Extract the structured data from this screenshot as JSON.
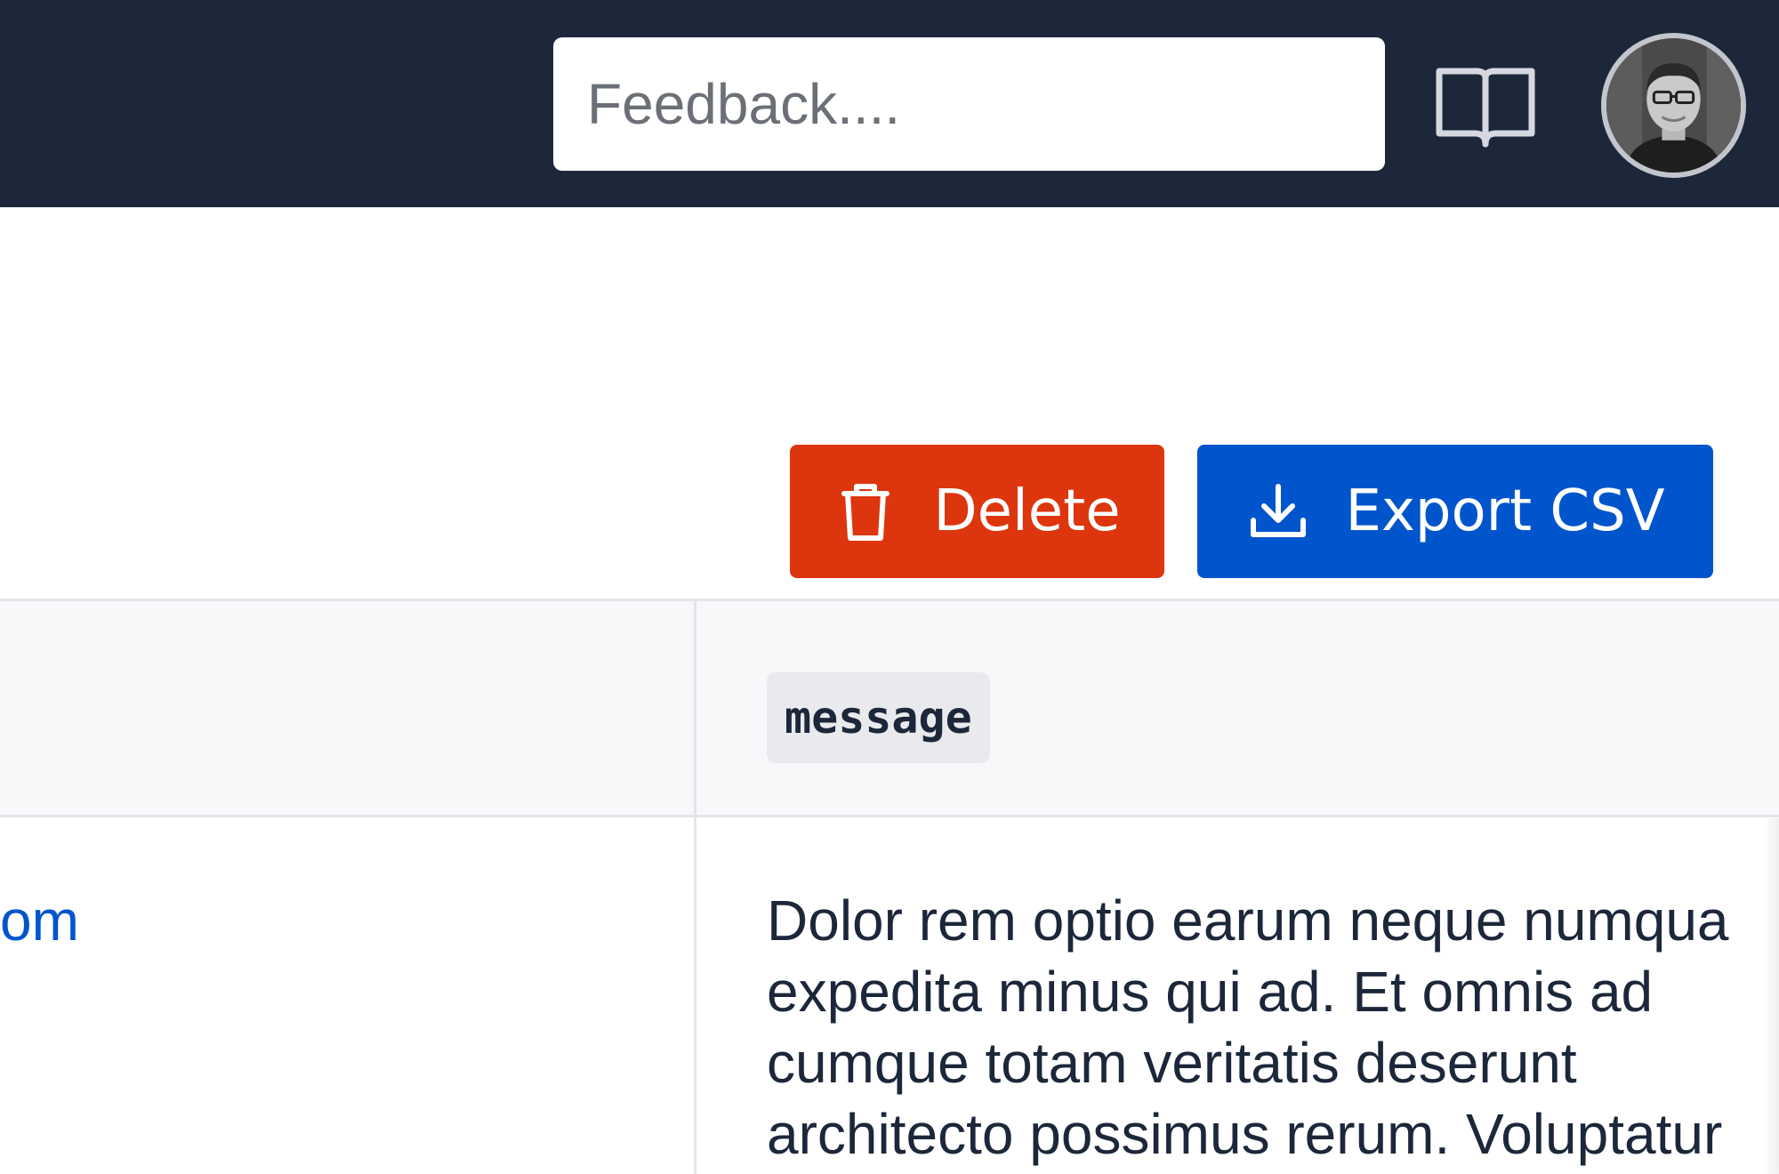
{
  "topbar": {
    "feedback_placeholder": "Feedback....",
    "docs_icon": "book-open-icon",
    "avatar_alt": "User avatar"
  },
  "toolbar": {
    "delete_label": "Delete",
    "delete_icon": "trash-icon",
    "export_label": "Export CSV",
    "export_icon": "download-icon"
  },
  "colors": {
    "nav_background": "#1c273a",
    "delete_red": "#dd350d",
    "primary_blue": "#0055cc",
    "text_dark": "#1c273a"
  },
  "table": {
    "columns": [
      "",
      "message"
    ],
    "rows": [
      {
        "email": "om",
        "message_lines": [
          "Dolor rem optio earum neque numqua",
          "expedita minus qui ad. Et omnis ad",
          "cumque totam veritatis deserunt",
          "architecto possimus rerum. Voluptatur"
        ]
      }
    ]
  }
}
